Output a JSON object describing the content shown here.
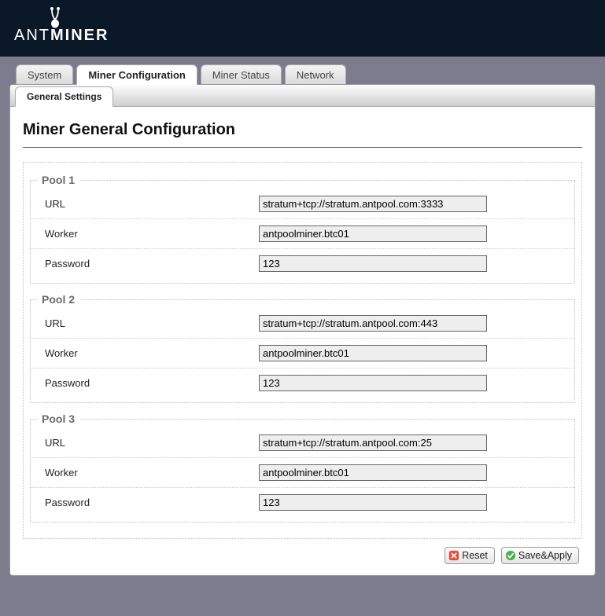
{
  "logo": {
    "prefix": "ANT",
    "suffix": "MINER"
  },
  "tabs": {
    "system": "System",
    "miner_config": "Miner Configuration",
    "miner_status": "Miner Status",
    "network": "Network"
  },
  "subtabs": {
    "general": "General Settings"
  },
  "page_title": "Miner General Configuration",
  "labels": {
    "url": "URL",
    "worker": "Worker",
    "password": "Password"
  },
  "pools": [
    {
      "legend": "Pool 1",
      "url": "stratum+tcp://stratum.antpool.com:3333",
      "worker": "antpoolminer.btc01",
      "password": "123"
    },
    {
      "legend": "Pool 2",
      "url": "stratum+tcp://stratum.antpool.com:443",
      "worker": "antpoolminer.btc01",
      "password": "123"
    },
    {
      "legend": "Pool 3",
      "url": "stratum+tcp://stratum.antpool.com:25",
      "worker": "antpoolminer.btc01",
      "password": "123"
    }
  ],
  "buttons": {
    "reset": "Reset",
    "save_apply": "Save&Apply"
  }
}
